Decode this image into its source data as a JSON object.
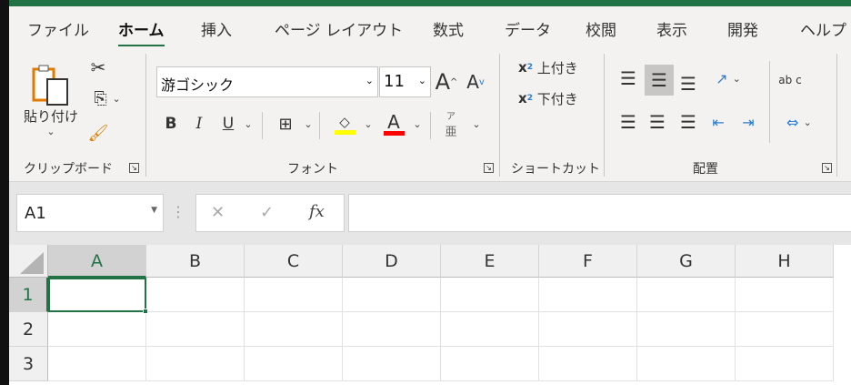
{
  "tabs": [
    "ファイル",
    "ホーム",
    "挿入",
    "ページ レイアウト",
    "数式",
    "データ",
    "校閲",
    "表示",
    "開発",
    "ヘルプ"
  ],
  "active_tab": "ホーム",
  "clipboard": {
    "paste": "貼り付け",
    "group": "クリップボード"
  },
  "font": {
    "name": "游ゴシック",
    "size": "11",
    "bold": "B",
    "italic": "I",
    "underline": "U",
    "grow": "A",
    "shrink": "A",
    "color_letter": "A",
    "phonetic_top": "ア",
    "phonetic_bottom": "亜",
    "group": "フォント",
    "fill_color": "#ffff00",
    "font_color": "#ff0000"
  },
  "shortcut": {
    "superscript": "上付き",
    "subscript": "下付き",
    "sup_mark": "x",
    "sub_mark": "x",
    "sup_num": "2",
    "sub_num": "2",
    "group": "ショートカット"
  },
  "alignment": {
    "group": "配置",
    "wrap_text": "ab c"
  },
  "formula_bar": {
    "name_box": "A1",
    "cancel": "✕",
    "enter": "✓",
    "fx": "fx",
    "formula": ""
  },
  "columns": [
    "A",
    "B",
    "C",
    "D",
    "E",
    "F",
    "G",
    "H"
  ],
  "rows": [
    "1",
    "2",
    "3"
  ],
  "selected_cell": "A1",
  "colors": {
    "accent": "#217346"
  }
}
